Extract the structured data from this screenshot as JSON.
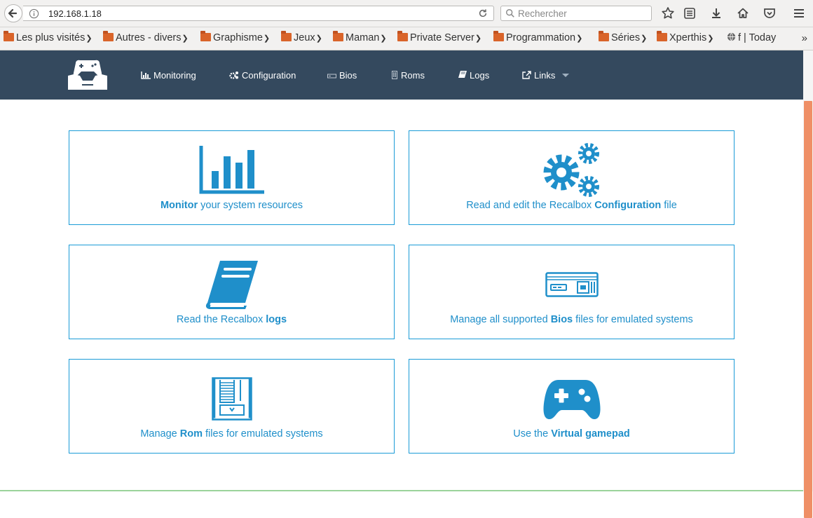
{
  "browser": {
    "url": "192.168.1.18",
    "search_placeholder": "Rechercher",
    "bookmarks": [
      {
        "label": "Les plus visités",
        "icon": "folder-icon",
        "chevron": true
      },
      {
        "label": "Autres - divers",
        "icon": "folder-icon",
        "chevron": true
      },
      {
        "label": "Graphisme",
        "icon": "folder-icon",
        "chevron": true
      },
      {
        "label": "Jeux",
        "icon": "folder-icon",
        "chevron": true
      },
      {
        "label": "Maman",
        "icon": "folder-icon",
        "chevron": true
      },
      {
        "label": "Private Server",
        "icon": "folder-icon",
        "chevron": true
      },
      {
        "label": "Programmation",
        "icon": "folder-icon",
        "chevron": true
      },
      {
        "label": "Séries",
        "icon": "folder-icon",
        "chevron": true
      },
      {
        "label": "Xperthis",
        "icon": "folder-icon",
        "chevron": true
      },
      {
        "label": "f | Today",
        "icon": "globe-icon",
        "chevron": false
      }
    ],
    "overflow": "»"
  },
  "nav": {
    "items": [
      {
        "label": "Monitoring",
        "icon": "bar-chart-icon"
      },
      {
        "label": "Configuration",
        "icon": "cogs-icon"
      },
      {
        "label": "Bios",
        "icon": "console-icon"
      },
      {
        "label": "Roms",
        "icon": "cartridge-icon"
      },
      {
        "label": "Logs",
        "icon": "book-icon"
      },
      {
        "label": "Links",
        "icon": "external-link-icon"
      }
    ]
  },
  "cards": [
    {
      "icon": "bar-chart-icon",
      "pre": "",
      "bold": "Monitor",
      "post": " your system resources"
    },
    {
      "icon": "cogs-icon",
      "pre": "Read and edit the Recalbox ",
      "bold": "Configuration",
      "post": " file"
    },
    {
      "icon": "book-icon",
      "pre": "Read the Recalbox ",
      "bold": "logs",
      "post": ""
    },
    {
      "icon": "console-icon",
      "pre": "Manage all supported ",
      "bold": "Bios",
      "post": " files for emulated systems"
    },
    {
      "icon": "cartridge-icon",
      "pre": "Manage ",
      "bold": "Rom",
      "post": " files for emulated systems"
    },
    {
      "icon": "gamepad-icon",
      "pre": "Use the ",
      "bold": "Virtual gamepad",
      "post": ""
    }
  ],
  "colors": {
    "navbar": "#34495e",
    "accent": "#1a9bd7",
    "icon": "#1f8fca",
    "scroll_thumb": "#ef8f66"
  }
}
